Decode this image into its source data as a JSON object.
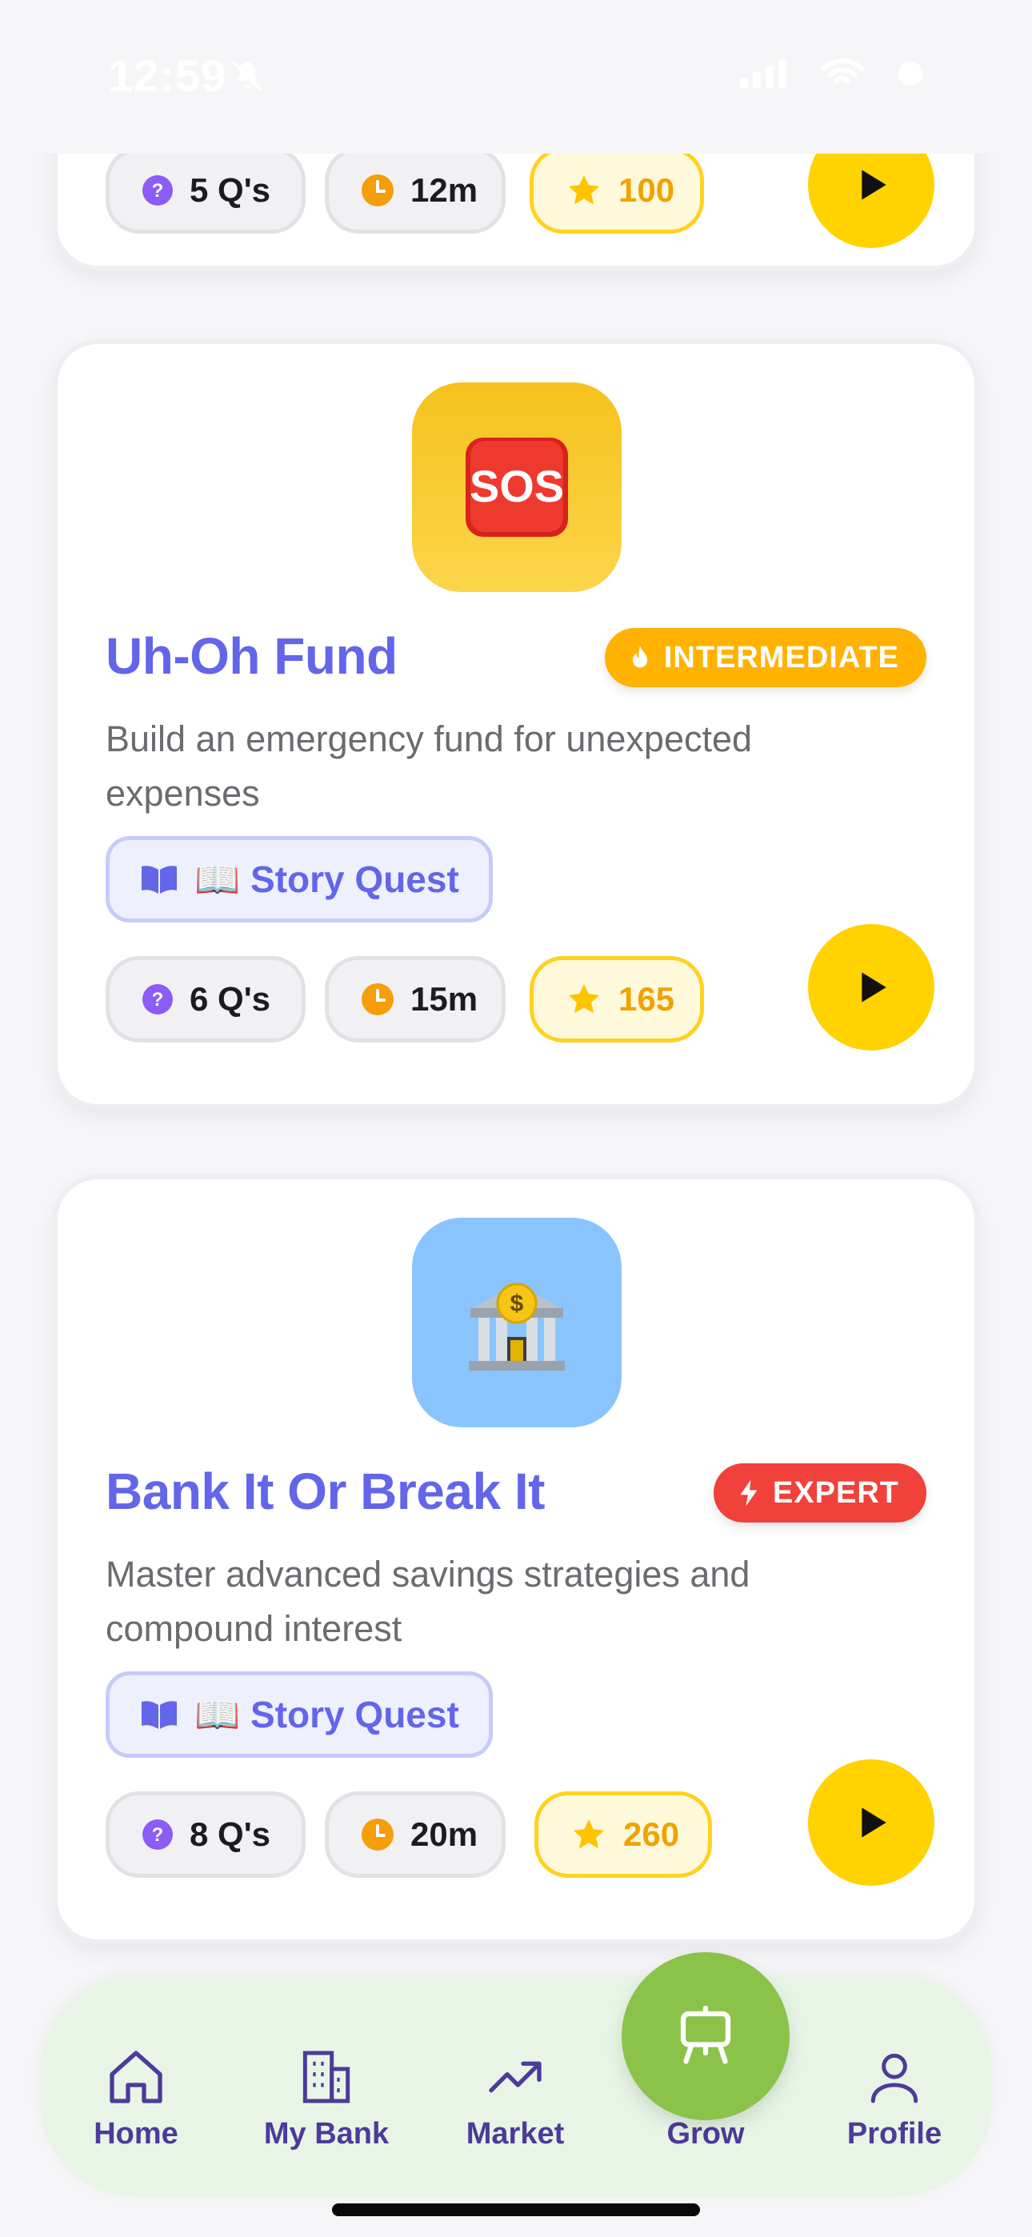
{
  "status_bar": {
    "time": "12:59"
  },
  "cards": [
    {
      "stats": {
        "questions": "5 Q's",
        "time": "12m",
        "points": "100"
      }
    },
    {
      "icon": "sos-icon",
      "icon_text": "SOS",
      "title": "Uh-Oh Fund",
      "level": "INTERMEDIATE",
      "level_color": "#ffb200",
      "description": "Build an emergency fund for unexpected expenses",
      "tag": "📖 Story Quest",
      "stats": {
        "questions": "6 Q's",
        "time": "15m",
        "points": "165"
      }
    },
    {
      "icon": "bank-icon",
      "title": "Bank It Or Break It",
      "level": "EXPERT",
      "level_color": "#f0413a",
      "description": "Master advanced savings strategies and compound interest",
      "tag": "📖 Story Quest",
      "stats": {
        "questions": "8 Q's",
        "time": "20m",
        "points": "260"
      }
    }
  ],
  "tab_bar": {
    "home": "Home",
    "bank": "My Bank",
    "market": "Market",
    "grow": "Grow",
    "profile": "Profile"
  },
  "colors": {
    "accent": "#6366e8",
    "play": "#ffd200",
    "grow": "#8bc34a",
    "tab_bg": "#e8f5e6"
  }
}
